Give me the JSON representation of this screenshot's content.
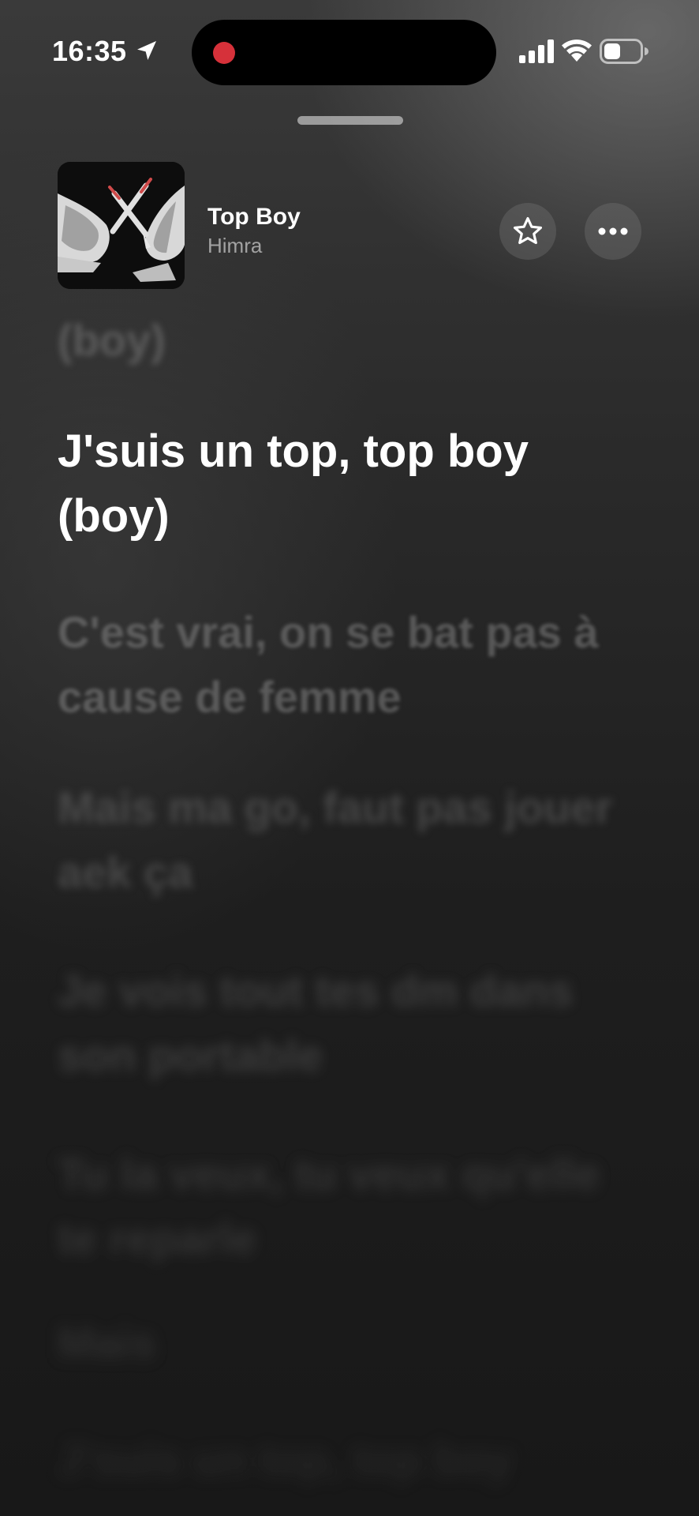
{
  "status_bar": {
    "time": "16:35",
    "icons": [
      "location-arrow-icon",
      "cellular-signal-icon",
      "wifi-icon",
      "battery-icon"
    ],
    "recording_indicator_color": "#d6313a"
  },
  "now_playing": {
    "title": "Top Boy",
    "artist": "Himra",
    "artwork_icon": "album-artwork",
    "favorite_icon": "star-icon",
    "more_icon": "ellipsis-icon"
  },
  "lyrics": {
    "previous": "(boy)",
    "active": "J'suis un top, top boy (boy)",
    "upcoming": [
      "C'est vrai, on se bat pas à cause de femme",
      "Mais ma go, faut pas jouer aek ça",
      "Je vois tout tes dm dans son portable",
      "Tu la veux, tu veux qu'elle te reparle",
      "Mais",
      "J'suis un top, top boy"
    ]
  },
  "colors": {
    "background": "#1a1a1a",
    "active_lyric": "#ffffff",
    "inactive_lyric": "#8c8c8c"
  }
}
